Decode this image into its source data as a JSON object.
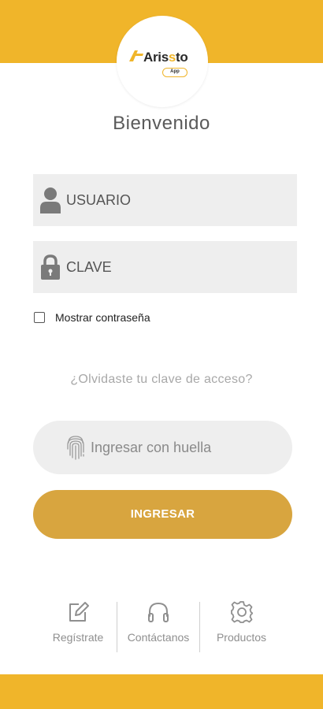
{
  "brand": {
    "logo_text_main": "Aris",
    "logo_text_accent": "s",
    "logo_text_tail": "to",
    "logo_badge": "App",
    "primary_color": "#f0b52a",
    "button_color": "#d8a53f"
  },
  "welcome_title": "Bienvenido",
  "login": {
    "user_placeholder": "USUARIO",
    "password_placeholder": "CLAVE",
    "user_icon": "user-icon",
    "password_icon": "lock-icon"
  },
  "show_password": {
    "label": "Mostrar contraseña",
    "checked": false
  },
  "forgot_link": "¿Olvidaste tu clave de acceso?",
  "fingerprint_button": {
    "label": "Ingresar con huella",
    "icon": "fingerprint-icon"
  },
  "submit_button": {
    "label": "INGRESAR"
  },
  "bottom_nav": {
    "items": [
      {
        "label": "Regístrate",
        "icon": "edit-icon"
      },
      {
        "label": "Contáctanos",
        "icon": "headphones-icon"
      },
      {
        "label": "Productos",
        "icon": "gear-icon"
      }
    ]
  }
}
